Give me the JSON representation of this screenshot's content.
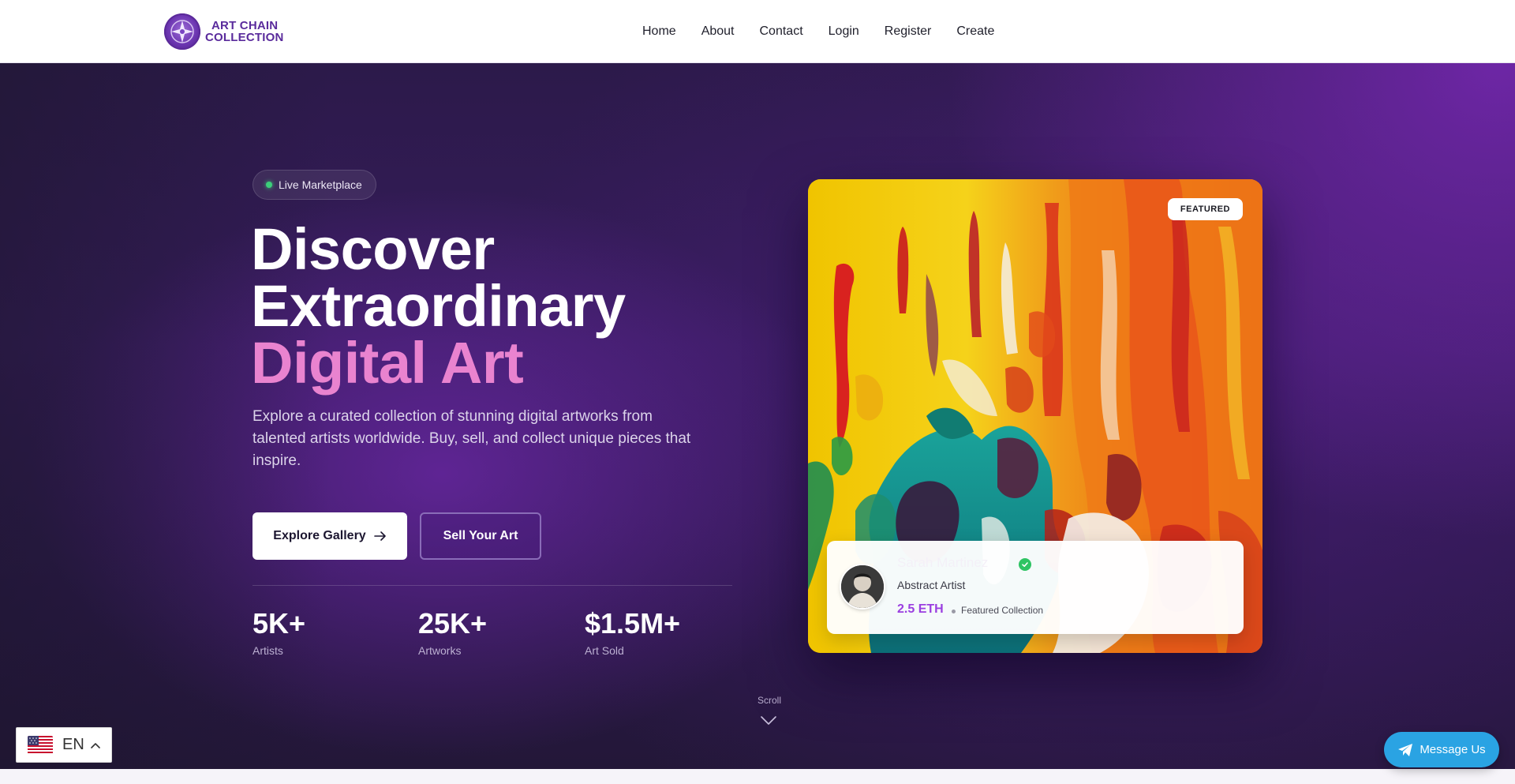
{
  "brand": {
    "line1": "ART CHAIN",
    "line2": "COLLECTION",
    "color": "#5a2b9c"
  },
  "nav": {
    "items": [
      {
        "label": "Home"
      },
      {
        "label": "About"
      },
      {
        "label": "Contact"
      },
      {
        "label": "Login"
      },
      {
        "label": "Register"
      },
      {
        "label": "Create"
      }
    ]
  },
  "hero": {
    "badge": "Live Marketplace",
    "title_line1": "Discover",
    "title_line2": "Extraordinary",
    "title_accent": "Digital Art",
    "accent_color": "#e983cf",
    "description": "Explore a curated collection of stunning digital artworks from talented artists worldwide. Buy, sell, and collect unique pieces that inspire.",
    "primary_button": "Explore Gallery",
    "secondary_button": "Sell Your Art",
    "stats": [
      {
        "value": "5K+",
        "label": "Artists"
      },
      {
        "value": "25K+",
        "label": "Artworks"
      },
      {
        "value": "$1.5M+",
        "label": "Art Sold"
      }
    ]
  },
  "featured": {
    "badge": "FEATURED",
    "artist_name": "Sarah Martinez",
    "artist_role": "Abstract Artist",
    "price": "2.5 ETH",
    "collection": "Featured Collection",
    "verified_color": "#2ec463",
    "price_color": "#9b3fe0"
  },
  "scroll": {
    "label": "Scroll"
  },
  "language": {
    "selected": "EN",
    "flag": "us-flag-icon"
  },
  "message": {
    "label": "Message Us",
    "color": "#2aa3e3"
  }
}
